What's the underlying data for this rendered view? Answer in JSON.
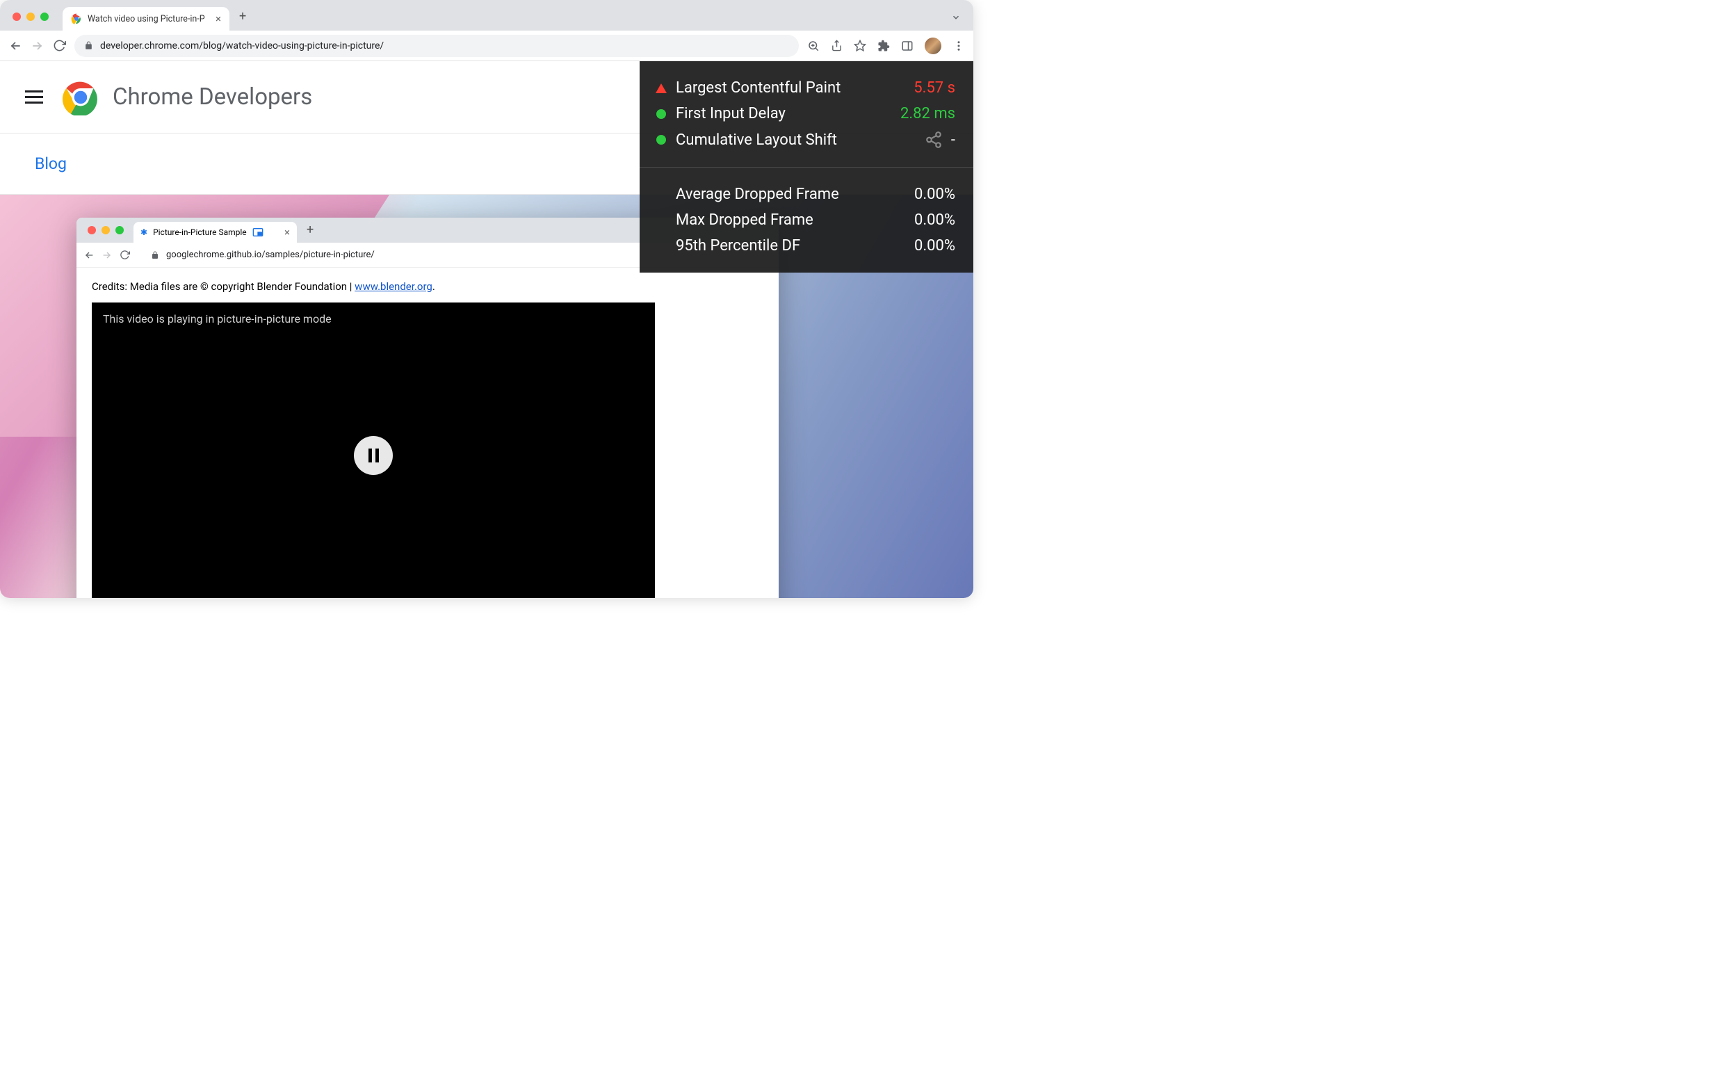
{
  "outer_browser": {
    "tab_title": "Watch video using Picture-in-P",
    "url": "developer.chrome.com/blog/watch-video-using-picture-in-picture/"
  },
  "site": {
    "title": "Chrome Developers",
    "breadcrumb": "Blog"
  },
  "inner_browser": {
    "tab_title": "Picture-in-Picture Sample",
    "url": "googlechrome.github.io/samples/picture-in-picture/",
    "credits_prefix": "Credits: Media files are © copyright Blender Foundation | ",
    "credits_link_text": "www.blender.org",
    "credits_suffix": ".",
    "video_message": "This video is playing in picture-in-picture mode"
  },
  "metrics": {
    "vitals": [
      {
        "label": "Largest Contentful Paint",
        "value": "5.57 s",
        "status": "bad"
      },
      {
        "label": "First Input Delay",
        "value": "2.82 ms",
        "status": "good"
      },
      {
        "label": "Cumulative Layout Shift",
        "value": "-",
        "status": "good"
      }
    ],
    "frames": [
      {
        "label": "Average Dropped Frame",
        "value": "0.00%"
      },
      {
        "label": "Max Dropped Frame",
        "value": "0.00%"
      },
      {
        "label": "95th Percentile DF",
        "value": "0.00%"
      }
    ]
  }
}
